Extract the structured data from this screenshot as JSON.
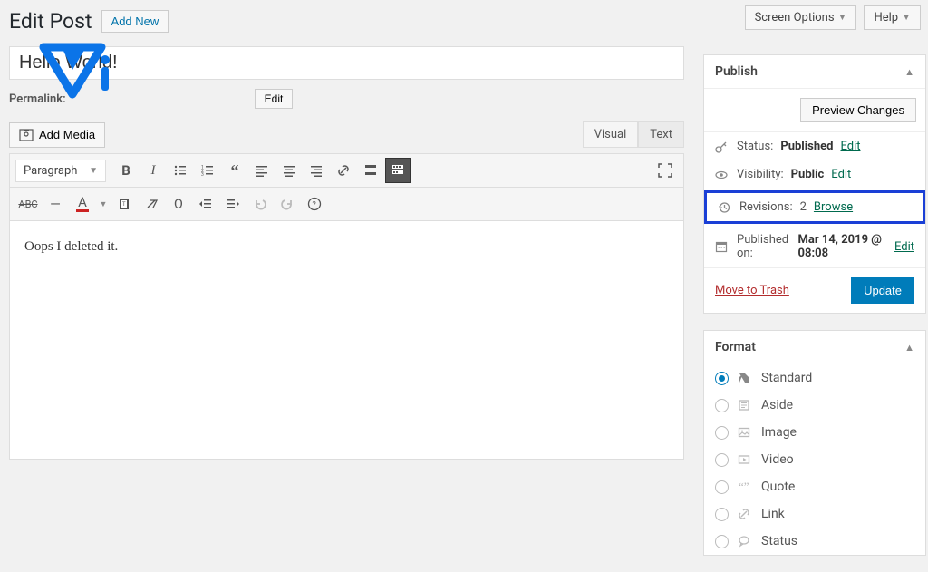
{
  "topbar": {
    "screenOptions": "Screen Options",
    "help": "Help"
  },
  "header": {
    "title": "Edit Post",
    "addNew": "Add New"
  },
  "post": {
    "title": "Hello World!",
    "permalinkLabel": "Permalink:",
    "editBtn": "Edit"
  },
  "editor": {
    "addMedia": "Add Media",
    "visualTab": "Visual",
    "textTab": "Text",
    "formatSelect": "Paragraph",
    "content": "Oops I deleted it."
  },
  "publish": {
    "heading": "Publish",
    "preview": "Preview Changes",
    "statusLabel": "Status:",
    "statusValue": "Published",
    "statusEdit": "Edit",
    "visibilityLabel": "Visibility:",
    "visibilityValue": "Public",
    "visibilityEdit": "Edit",
    "revisionsLabel": "Revisions:",
    "revisionsCount": "2",
    "revisionsBrowse": "Browse",
    "publishedLabel": "Published on:",
    "publishedValue": "Mar 14, 2019 @ 08:08",
    "publishedEdit": "Edit",
    "trash": "Move to Trash",
    "update": "Update"
  },
  "format": {
    "heading": "Format",
    "options": [
      "Standard",
      "Aside",
      "Image",
      "Video",
      "Quote",
      "Link",
      "Status"
    ],
    "selected": "Standard"
  }
}
